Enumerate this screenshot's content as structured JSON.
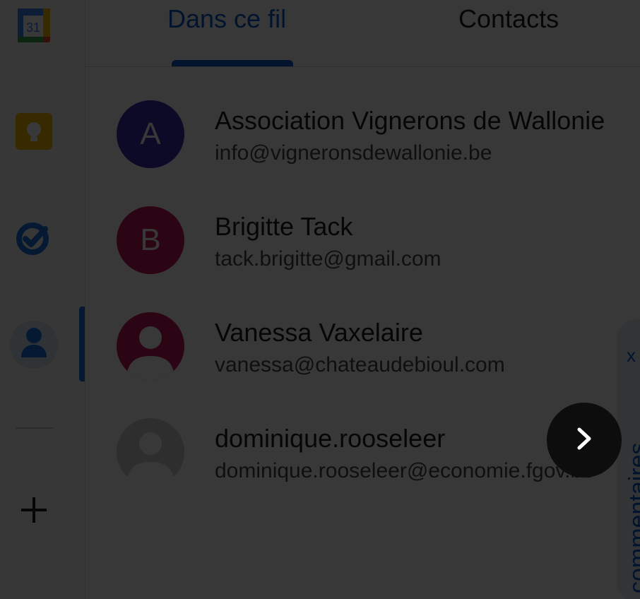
{
  "rail": {
    "items": [
      {
        "name": "calendar",
        "icon": "calendar-icon",
        "label": "31"
      },
      {
        "name": "keep",
        "icon": "keep-bulb-icon"
      },
      {
        "name": "tasks",
        "icon": "tasks-check-icon"
      },
      {
        "name": "contacts",
        "icon": "contacts-person-icon"
      }
    ],
    "add_icon": "plus-icon"
  },
  "tabs": {
    "active_label": "Dans ce fil",
    "other_label": "Contacts"
  },
  "contacts": [
    {
      "initial": "A",
      "name": "Association Vignerons de Wallonie",
      "email": "info@vigneronsdewallonie.be",
      "color": "#3d2fb0"
    },
    {
      "initial": "B",
      "name": "Brigitte Tack",
      "email": "tack.brigitte@gmail.com",
      "color": "#c2185b"
    },
    {
      "initial": "",
      "name": "Vanessa Vaxelaire",
      "email": "vanessa@chateaudebioul.com",
      "color": "#c2185b",
      "photo_style": "person"
    },
    {
      "initial": "",
      "name": "dominique.rooseleer",
      "email": "dominique.rooseleer@economie.fgov.be",
      "color": "#d3d3d3",
      "photo_style": "default"
    }
  ],
  "side_panel": {
    "label": "commentaires",
    "close": "x"
  },
  "fab": {
    "icon": "chevron-right-icon"
  },
  "colors": {
    "accent": "#0b57d0",
    "overlay": "rgba(0,0,0,0.78)"
  }
}
